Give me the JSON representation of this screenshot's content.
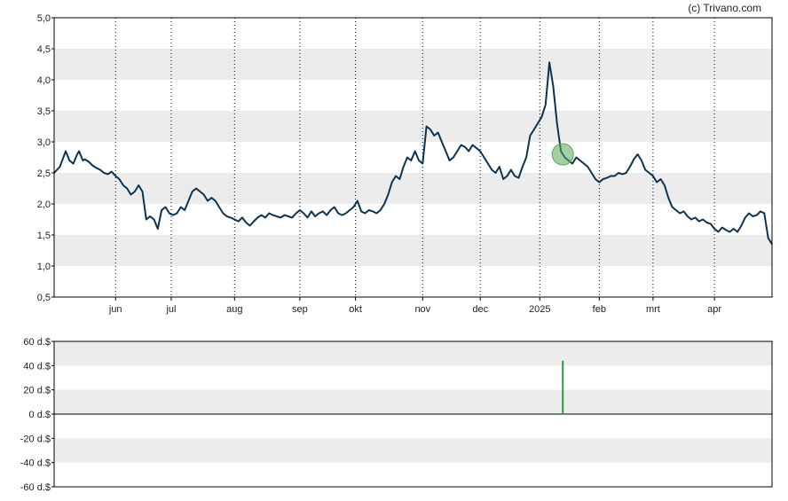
{
  "credit": "(c) Trivano.com",
  "colors": {
    "line": "#0d3350",
    "band": "#ececec",
    "marker": "#5aaa5a",
    "volume": "#2e9a3e",
    "grid": "#000000"
  },
  "chart_data": [
    {
      "type": "line",
      "title": "",
      "xlabel": "",
      "ylabel": "",
      "ylim": [
        0.5,
        5.0
      ],
      "y_ticks": [
        "0,5",
        "1,0",
        "1,5",
        "2,0",
        "2,5",
        "3,0",
        "3,5",
        "4,0",
        "4,5",
        "5,0"
      ],
      "x_range": [
        0,
        374
      ],
      "x_ticks": [
        {
          "label": "jun",
          "x": 32
        },
        {
          "label": "jul",
          "x": 61
        },
        {
          "label": "aug",
          "x": 94
        },
        {
          "label": "sep",
          "x": 128
        },
        {
          "label": "okt",
          "x": 157
        },
        {
          "label": "nov",
          "x": 192
        },
        {
          "label": "dec",
          "x": 222
        },
        {
          "label": "2025",
          "x": 253
        },
        {
          "label": "feb",
          "x": 284
        },
        {
          "label": "mrt",
          "x": 312
        },
        {
          "label": "apr",
          "x": 344
        }
      ],
      "grid": "vertical dotted at month starts, alternating horizontal bands",
      "marker": {
        "x": 265,
        "y": 2.8
      },
      "series": [
        {
          "points": [
            [
              0,
              2.5
            ],
            [
              3,
              2.6
            ],
            [
              6,
              2.85
            ],
            [
              8,
              2.7
            ],
            [
              10,
              2.65
            ],
            [
              12,
              2.8
            ],
            [
              13,
              2.85
            ],
            [
              15,
              2.7
            ],
            [
              16,
              2.72
            ],
            [
              18,
              2.68
            ],
            [
              20,
              2.62
            ],
            [
              22,
              2.58
            ],
            [
              24,
              2.55
            ],
            [
              26,
              2.5
            ],
            [
              28,
              2.48
            ],
            [
              30,
              2.52
            ],
            [
              32,
              2.45
            ],
            [
              34,
              2.4
            ],
            [
              36,
              2.3
            ],
            [
              38,
              2.25
            ],
            [
              40,
              2.15
            ],
            [
              42,
              2.2
            ],
            [
              44,
              2.3
            ],
            [
              46,
              2.2
            ],
            [
              48,
              1.75
            ],
            [
              50,
              1.8
            ],
            [
              52,
              1.75
            ],
            [
              54,
              1.6
            ],
            [
              56,
              1.9
            ],
            [
              58,
              1.95
            ],
            [
              60,
              1.85
            ],
            [
              62,
              1.82
            ],
            [
              64,
              1.85
            ],
            [
              66,
              1.95
            ],
            [
              68,
              1.9
            ],
            [
              70,
              2.05
            ],
            [
              72,
              2.2
            ],
            [
              74,
              2.25
            ],
            [
              76,
              2.2
            ],
            [
              78,
              2.15
            ],
            [
              80,
              2.05
            ],
            [
              82,
              2.1
            ],
            [
              84,
              2.05
            ],
            [
              86,
              1.95
            ],
            [
              88,
              1.85
            ],
            [
              90,
              1.8
            ],
            [
              92,
              1.78
            ],
            [
              94,
              1.75
            ],
            [
              96,
              1.72
            ],
            [
              98,
              1.78
            ],
            [
              100,
              1.7
            ],
            [
              102,
              1.65
            ],
            [
              104,
              1.72
            ],
            [
              106,
              1.78
            ],
            [
              108,
              1.82
            ],
            [
              110,
              1.78
            ],
            [
              112,
              1.85
            ],
            [
              114,
              1.82
            ],
            [
              116,
              1.8
            ],
            [
              118,
              1.78
            ],
            [
              120,
              1.82
            ],
            [
              122,
              1.8
            ],
            [
              124,
              1.78
            ],
            [
              126,
              1.85
            ],
            [
              128,
              1.9
            ],
            [
              130,
              1.85
            ],
            [
              132,
              1.78
            ],
            [
              134,
              1.88
            ],
            [
              136,
              1.8
            ],
            [
              138,
              1.85
            ],
            [
              140,
              1.88
            ],
            [
              142,
              1.82
            ],
            [
              144,
              1.9
            ],
            [
              146,
              1.95
            ],
            [
              148,
              1.85
            ],
            [
              150,
              1.82
            ],
            [
              152,
              1.85
            ],
            [
              154,
              1.9
            ],
            [
              156,
              1.95
            ],
            [
              158,
              2.05
            ],
            [
              160,
              1.88
            ],
            [
              162,
              1.85
            ],
            [
              164,
              1.9
            ],
            [
              166,
              1.88
            ],
            [
              168,
              1.85
            ],
            [
              170,
              1.9
            ],
            [
              172,
              2.0
            ],
            [
              174,
              2.15
            ],
            [
              176,
              2.35
            ],
            [
              178,
              2.45
            ],
            [
              180,
              2.4
            ],
            [
              182,
              2.6
            ],
            [
              184,
              2.75
            ],
            [
              186,
              2.7
            ],
            [
              188,
              2.85
            ],
            [
              190,
              2.7
            ],
            [
              192,
              2.65
            ],
            [
              194,
              3.25
            ],
            [
              196,
              3.2
            ],
            [
              198,
              3.1
            ],
            [
              200,
              3.15
            ],
            [
              202,
              3.0
            ],
            [
              204,
              2.85
            ],
            [
              206,
              2.7
            ],
            [
              208,
              2.75
            ],
            [
              210,
              2.85
            ],
            [
              212,
              2.95
            ],
            [
              214,
              2.92
            ],
            [
              216,
              2.85
            ],
            [
              218,
              2.95
            ],
            [
              220,
              2.9
            ],
            [
              222,
              2.85
            ],
            [
              224,
              2.75
            ],
            [
              226,
              2.65
            ],
            [
              228,
              2.55
            ],
            [
              230,
              2.5
            ],
            [
              232,
              2.6
            ],
            [
              234,
              2.4
            ],
            [
              236,
              2.45
            ],
            [
              238,
              2.55
            ],
            [
              240,
              2.45
            ],
            [
              242,
              2.42
            ],
            [
              244,
              2.6
            ],
            [
              246,
              2.75
            ],
            [
              248,
              3.1
            ],
            [
              250,
              3.2
            ],
            [
              252,
              3.3
            ],
            [
              254,
              3.4
            ],
            [
              256,
              3.6
            ],
            [
              258,
              4.28
            ],
            [
              260,
              3.9
            ],
            [
              262,
              3.3
            ],
            [
              264,
              2.85
            ],
            [
              266,
              2.75
            ],
            [
              268,
              2.7
            ],
            [
              270,
              2.65
            ],
            [
              272,
              2.75
            ],
            [
              274,
              2.7
            ],
            [
              276,
              2.65
            ],
            [
              278,
              2.6
            ],
            [
              280,
              2.5
            ],
            [
              282,
              2.4
            ],
            [
              284,
              2.35
            ],
            [
              286,
              2.4
            ],
            [
              288,
              2.42
            ],
            [
              290,
              2.45
            ],
            [
              292,
              2.45
            ],
            [
              294,
              2.5
            ],
            [
              296,
              2.48
            ],
            [
              298,
              2.5
            ],
            [
              300,
              2.6
            ],
            [
              302,
              2.72
            ],
            [
              304,
              2.8
            ],
            [
              306,
              2.7
            ],
            [
              308,
              2.55
            ],
            [
              310,
              2.5
            ],
            [
              312,
              2.45
            ],
            [
              314,
              2.35
            ],
            [
              316,
              2.4
            ],
            [
              318,
              2.3
            ],
            [
              320,
              2.1
            ],
            [
              322,
              1.95
            ],
            [
              324,
              1.9
            ],
            [
              326,
              1.85
            ],
            [
              328,
              1.88
            ],
            [
              330,
              1.8
            ],
            [
              332,
              1.75
            ],
            [
              334,
              1.78
            ],
            [
              336,
              1.72
            ],
            [
              338,
              1.75
            ],
            [
              340,
              1.7
            ],
            [
              342,
              1.68
            ],
            [
              344,
              1.6
            ],
            [
              346,
              1.55
            ],
            [
              348,
              1.62
            ],
            [
              350,
              1.58
            ],
            [
              352,
              1.55
            ],
            [
              354,
              1.6
            ],
            [
              356,
              1.55
            ],
            [
              358,
              1.65
            ],
            [
              360,
              1.78
            ],
            [
              362,
              1.85
            ],
            [
              364,
              1.8
            ],
            [
              366,
              1.82
            ],
            [
              368,
              1.88
            ],
            [
              370,
              1.85
            ],
            [
              372,
              1.45
            ],
            [
              374,
              1.35
            ]
          ]
        }
      ]
    },
    {
      "type": "bar",
      "title": "",
      "xlabel": "",
      "ylabel": "",
      "ylim": [
        -60,
        60
      ],
      "y_ticks": [
        "60 d.$",
        "40 d.$",
        "20 d.$",
        "0 d.$",
        "-20 d.$",
        "-40 d.$",
        "-60 d.$"
      ],
      "x_range": [
        0,
        374
      ],
      "bars": [
        {
          "x": 265,
          "value": 44
        }
      ]
    }
  ]
}
